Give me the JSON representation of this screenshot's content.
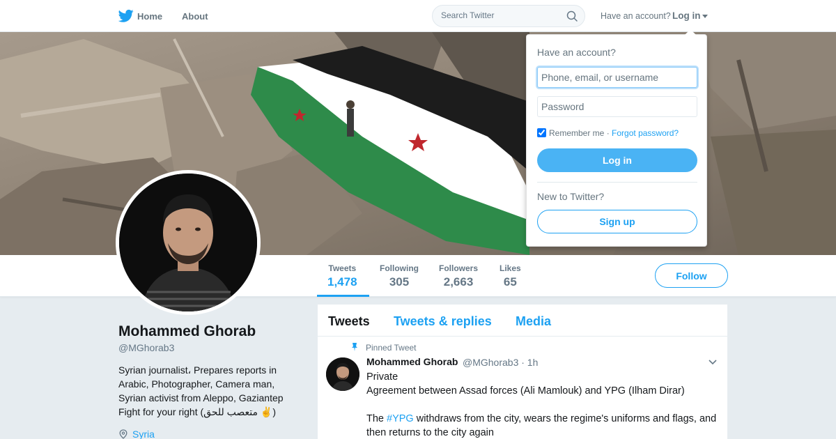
{
  "nav": {
    "home": "Home",
    "about": "About",
    "search_placeholder": "Search Twitter",
    "have_account": "Have an account?",
    "login": "Log in"
  },
  "profile": {
    "name": "Mohammed Ghorab",
    "handle": "@MGhorab3",
    "bio": "Syrian journalist، Prepares reports in Arabic, Photographer, Camera man, Syrian activist from Aleppo, Gaziantep\nFight for your right (متعصب للحق ✌️)",
    "location": "Syria",
    "stats": [
      {
        "label": "Tweets",
        "value": "1,478"
      },
      {
        "label": "Following",
        "value": "305"
      },
      {
        "label": "Followers",
        "value": "2,663"
      },
      {
        "label": "Likes",
        "value": "65"
      }
    ],
    "follow": "Follow"
  },
  "timeline": {
    "tabs": [
      "Tweets",
      "Tweets & replies",
      "Media"
    ],
    "pinned_label": "Pinned Tweet",
    "tweet": {
      "name": "Mohammed Ghorab",
      "handle_time": "@MGhorab3 · 1h",
      "line1": "Private",
      "line2": "Agreement between Assad forces (Ali Mamlouk) and YPG (Ilham Dirar)",
      "line3_pre": "The ",
      "line3_hash": "#YPG",
      "line3_post": " withdraws from the city, wears the regime's uniforms and flags, and then returns to the city again"
    }
  },
  "login_dropdown": {
    "title": "Have an account?",
    "username_placeholder": "Phone, email, or username",
    "password_placeholder": "Password",
    "remember": "Remember me",
    "separator": "·",
    "forgot": "Forgot password?",
    "login_button": "Log in",
    "new_to": "New to Twitter?",
    "signup_button": "Sign up"
  },
  "colors": {
    "accent": "#1da1f2",
    "login_button": "#4ab3f4",
    "background": "#e6ecf0"
  }
}
